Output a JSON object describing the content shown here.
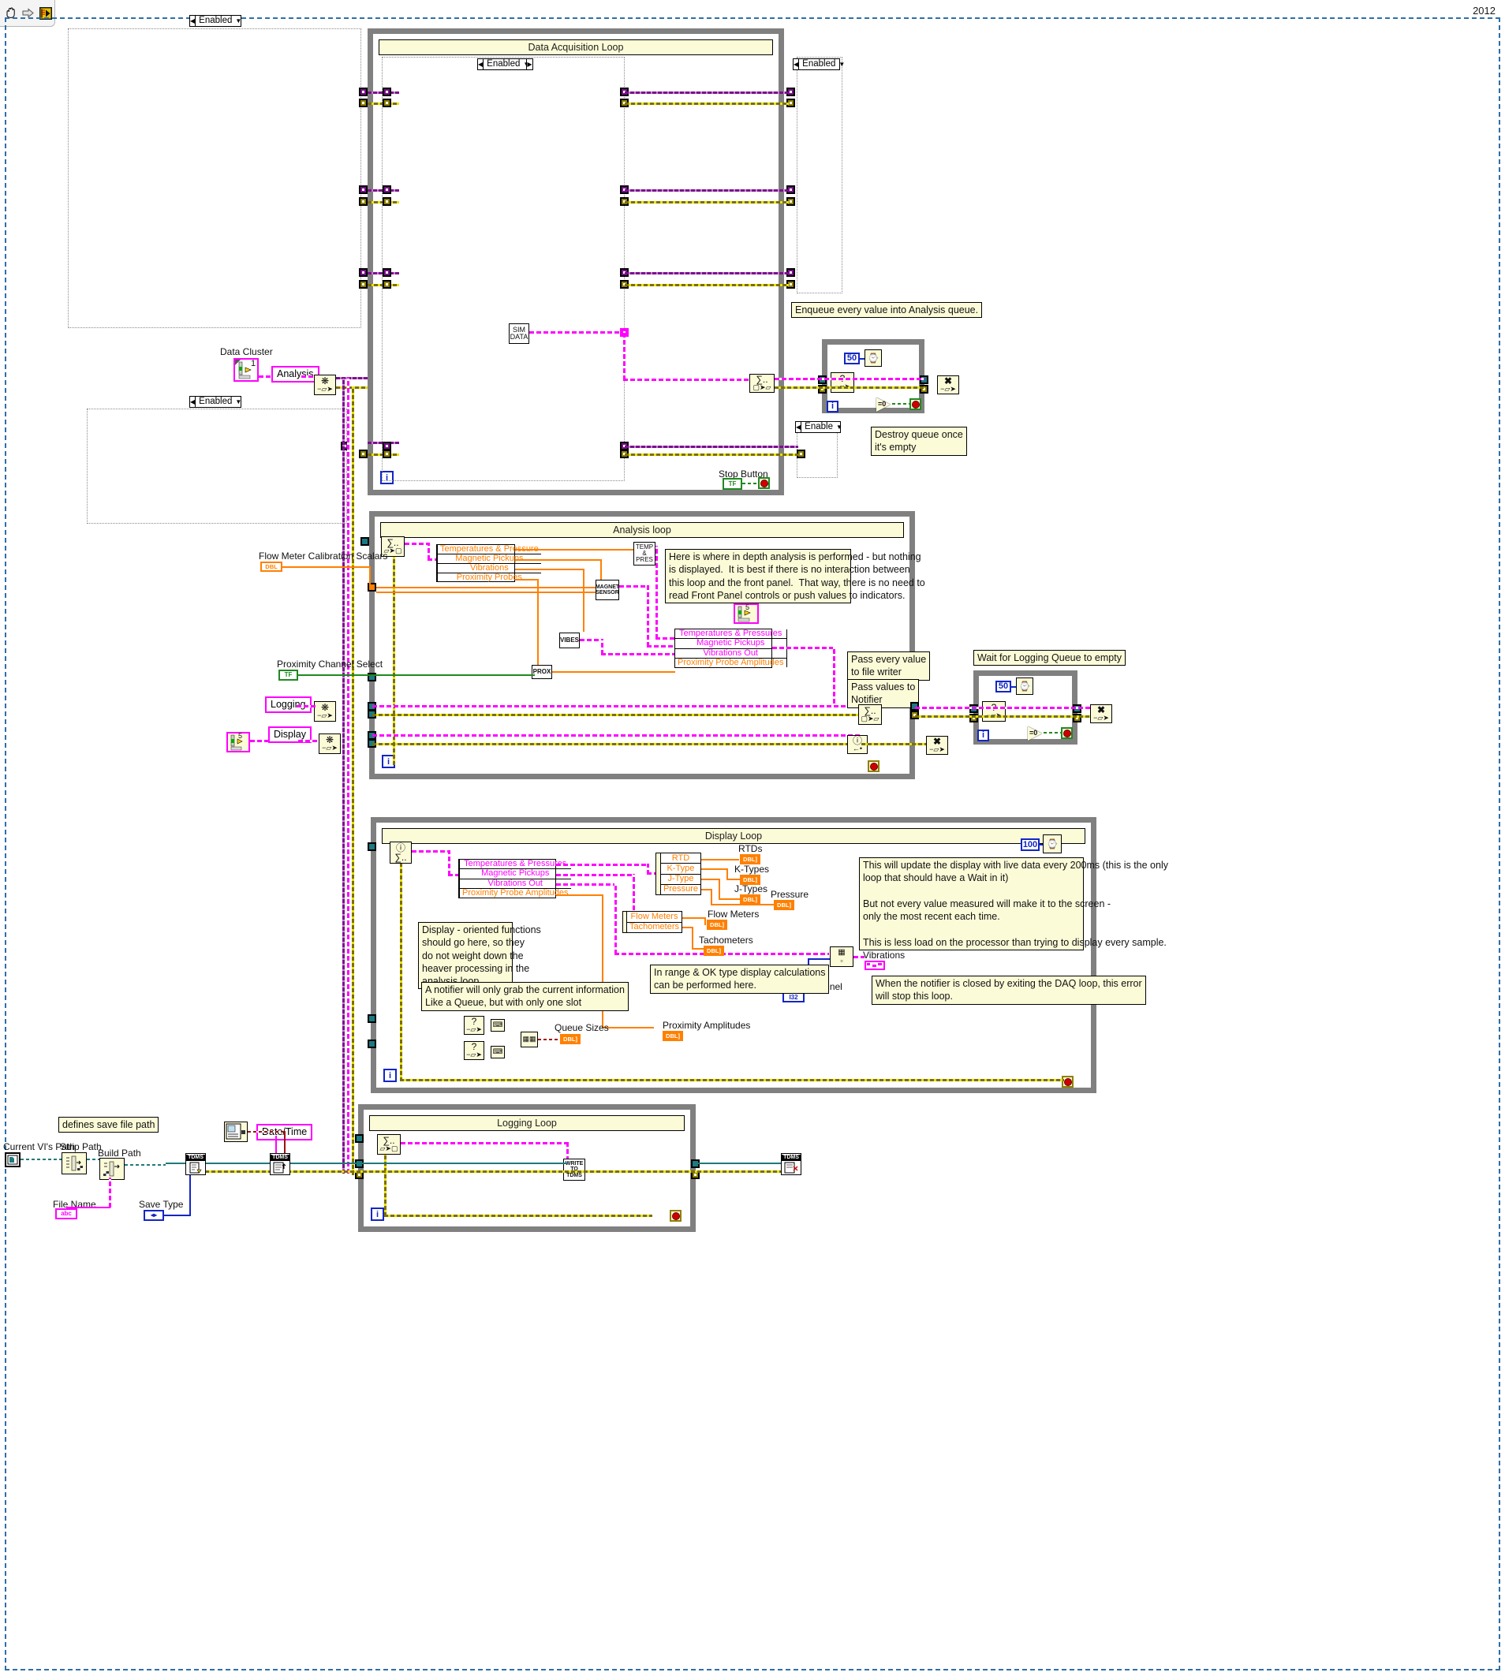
{
  "window": {
    "year_label": "2012",
    "toolbar_icons": [
      "hand-tool-icon",
      "arrow-right-icon",
      "labview-run-icon"
    ]
  },
  "structures": {
    "data_acquisition_loop": {
      "title": "Data Acquisition Loop",
      "iteration": "i",
      "enabled_selector_outer": "Enabled",
      "enabled_selector_inner": "Enabled",
      "enabled_selector_right": "Enabled",
      "enable_selector_small": "Enable",
      "sim_data_label": "SIM\nDATA",
      "stop_button_label": "Stop Button",
      "stop_button_value": "TF",
      "comment_enqueue": "Enqueue every value into Analysis queue.",
      "comment_destroy": "Destroy queue once\nit's empty",
      "wait_const": "50"
    },
    "analysis_loop": {
      "title": "Analysis loop",
      "iteration": "i",
      "bundle_in": [
        "Temperatures & Pressure",
        "Magnetic Pickups",
        "Vibrations",
        "Proximity Probes"
      ],
      "bundle_out": [
        "Temperatures & Pressures",
        "Magnetic Pickups",
        "Vibrations Out",
        "Proximity Probe Amplitudes"
      ],
      "subvi_temp_pres": "TEMP\n&\nPRES",
      "subvi_magnet": "MAGNET\nSENSOR",
      "subvi_vibes": "VIBES",
      "subvi_prox": "PROX",
      "comment_depth": "Here is where in depth analysis is performed - but nothing\nis displayed.  It is best if there is no interaction between\nthis loop and the front panel.  That way, there is no need to\nread Front Panel controls or push values to indicators.",
      "comment_file_writer": "Pass every value\nto file writer",
      "comment_notifier": "Pass values to\nNotifier",
      "comment_wait_logging": "Wait for Logging Queue to empty",
      "wait_const": "50"
    },
    "display_loop": {
      "title": "Display Loop",
      "iteration": "i",
      "bundle_in": [
        "Temperatures & Pressures",
        "Magnetic Pickups",
        "Vibrations Out",
        "Proximity Probe Amplitudes"
      ],
      "bundle_temp": [
        "RTD",
        "K-Type",
        "J-Type",
        "Pressure"
      ],
      "bundle_mag": [
        "Flow Meters",
        "Tachometers"
      ],
      "wait_const": "100",
      "comment_update": "This will update the display with live data every 200ms (this is the only\nloop that should have a Wait in it)\n\nBut not every value measured will make it to the screen -\nonly the most recent each time.\n\nThis is less load on the processor than trying to display every sample.",
      "comment_display_oriented": "Display - oriented functions\nshould go here, so they\ndo not weight down the\nheaver processing in the\nanalysis loop.",
      "comment_notifier_slot": "A notifier will only grab the current information\nLike a Queue, but with only one slot",
      "comment_inrange": "In range & OK type display calculations\ncan be performed here.",
      "comment_notifier_closed": "When the notifier is closed by exiting the DAQ loop, this error\nwill stop this loop.",
      "indicators": [
        {
          "label": "RTDs",
          "type": "DBL]"
        },
        {
          "label": "K-Types",
          "type": "DBL]"
        },
        {
          "label": "J-Types",
          "type": "DBL]"
        },
        {
          "label": "Pressure",
          "type": "DBL]"
        },
        {
          "label": "Flow Meters",
          "type": "DBL]"
        },
        {
          "label": "Tachometers",
          "type": "DBL]"
        },
        {
          "label": "Vibrations",
          "type": "graph"
        },
        {
          "label": "Proximity Amplitudes",
          "type": "DBL]"
        },
        {
          "label": "Queue Sizes",
          "type": "DBL]"
        }
      ],
      "vibes_channel_label": "Vibes Channel",
      "vibes_channel_value": "I32"
    },
    "logging_loop": {
      "title": "Logging Loop",
      "iteration": "i",
      "write_tdms_label": "WRITE\nTO\nTDMS"
    }
  },
  "controls": {
    "data_cluster_label": "Data Cluster",
    "data_cluster_value": "1",
    "analysis_label": "Analysis",
    "logging_label": "Logging",
    "display_label": "Display",
    "flow_meter_label": "Flow Meter Calibration Scalars",
    "flow_meter_type": "DBL",
    "proximity_label": "Proximity Channel Select",
    "proximity_value": "TF",
    "current_vi_path_label": "Current VI's Path",
    "strip_path_label": "Strip Path",
    "build_path_label": "Build Path",
    "file_name_label": "File Name",
    "file_name_value": "abc",
    "save_type_label": "Save Type",
    "date_time_label": "Date/Time",
    "comment_save_path": "defines save file path",
    "tdms_open_label": "TDMS",
    "tdms_props_label": "TDMS",
    "tdms_close_label": "TDMS"
  }
}
